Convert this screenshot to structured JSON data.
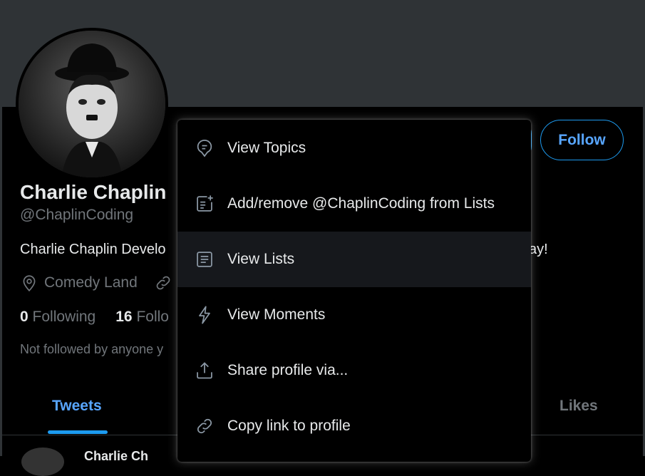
{
  "profile": {
    "name": "Charlie Chaplin",
    "handle": "@ChaplinCoding",
    "bio_visible": "Charlie Chaplin Develo",
    "bio_tail": "ay!",
    "location": "Comedy Land",
    "following_count": "0",
    "following_label": "Following",
    "followers_count": "16",
    "followers_label": "Follo",
    "followers_note": "Not followed by anyone y"
  },
  "actions": {
    "follow_label": "Follow"
  },
  "tabs": {
    "tweets": "Tweets",
    "likes": "Likes"
  },
  "tweet_peek": {
    "name": "Charlie Ch"
  },
  "menu": {
    "items": [
      {
        "label": "View Topics",
        "icon": "topics-icon"
      },
      {
        "label": "Add/remove @ChaplinCoding from Lists",
        "icon": "list-add-icon"
      },
      {
        "label": "View Lists",
        "icon": "lists-icon"
      },
      {
        "label": "View Moments",
        "icon": "moments-icon"
      },
      {
        "label": "Share profile via...",
        "icon": "share-icon"
      },
      {
        "label": "Copy link to profile",
        "icon": "link-icon"
      }
    ]
  },
  "colors": {
    "accent": "#1d9bf0",
    "background": "#000000",
    "banner": "#2f3336",
    "text_secondary": "#71767b"
  }
}
